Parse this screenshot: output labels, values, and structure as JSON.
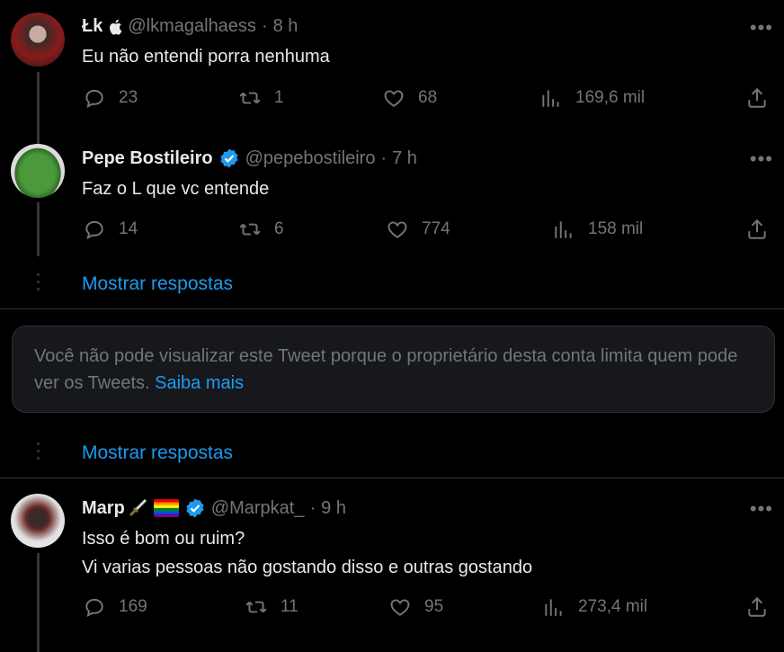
{
  "tweets": [
    {
      "name": "Łk",
      "handle": "@lkmagalhaess",
      "time": "8 h",
      "text": "Eu não entendi porra nenhuma",
      "replies": "23",
      "retweets": "1",
      "likes": "68",
      "views": "169,6 mil"
    },
    {
      "name": "Pepe Bostileiro",
      "handle": "@pepebostileiro",
      "time": "7 h",
      "text": "Faz o L que vc entende",
      "replies": "14",
      "retweets": "6",
      "likes": "774",
      "views": "158 mil"
    },
    {
      "name": "Marp",
      "handle": "@Marpkat_",
      "time": "9 h",
      "text_line1": "Isso é bom ou ruim?",
      "text_line2": "Vi varias pessoas não gostando disso e outras gostando",
      "replies": "169",
      "retweets": "11",
      "likes": "95",
      "views": "273,4 mil"
    }
  ],
  "show_replies_label": "Mostrar respostas",
  "restricted": {
    "text": "Você não pode visualizar este Tweet porque o proprietário desta conta limita quem pode ver os Tweets.",
    "link": "Saiba mais"
  },
  "separator": "·",
  "more_glyph": "•••",
  "colors": {
    "background": "#000000",
    "text": "#e7e9ea",
    "muted": "#71767b",
    "accent": "#1d9bf0",
    "border": "#2f3336"
  },
  "icons": [
    "apple-icon",
    "verified-icon",
    "reply-icon",
    "retweet-icon",
    "like-icon",
    "views-icon",
    "share-icon",
    "more-icon",
    "dagger-icon",
    "rainbow-flag-icon"
  ]
}
